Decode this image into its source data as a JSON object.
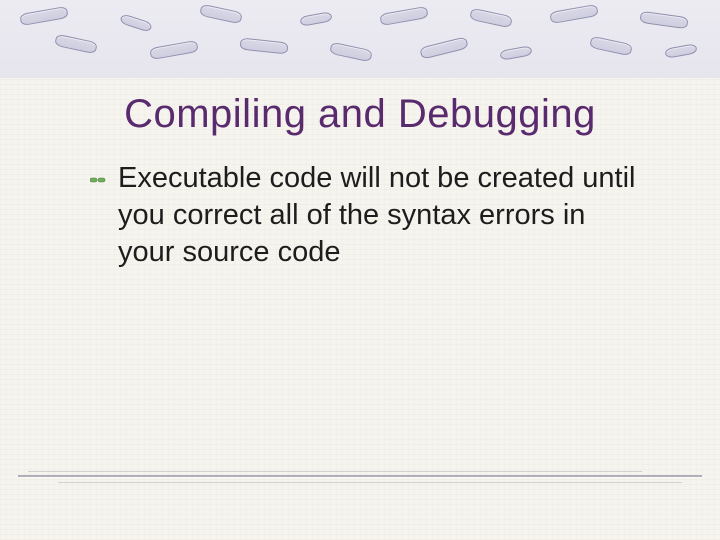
{
  "slide": {
    "title": "Compiling and Debugging",
    "bullets": [
      "Executable code will not be created until you correct all of the syntax errors in your source code"
    ]
  },
  "theme": {
    "title_color": "#5a2a6e",
    "body_color": "#1d1d1d",
    "background": "#f6f4ee",
    "accent_band": "#e6e5ee"
  }
}
